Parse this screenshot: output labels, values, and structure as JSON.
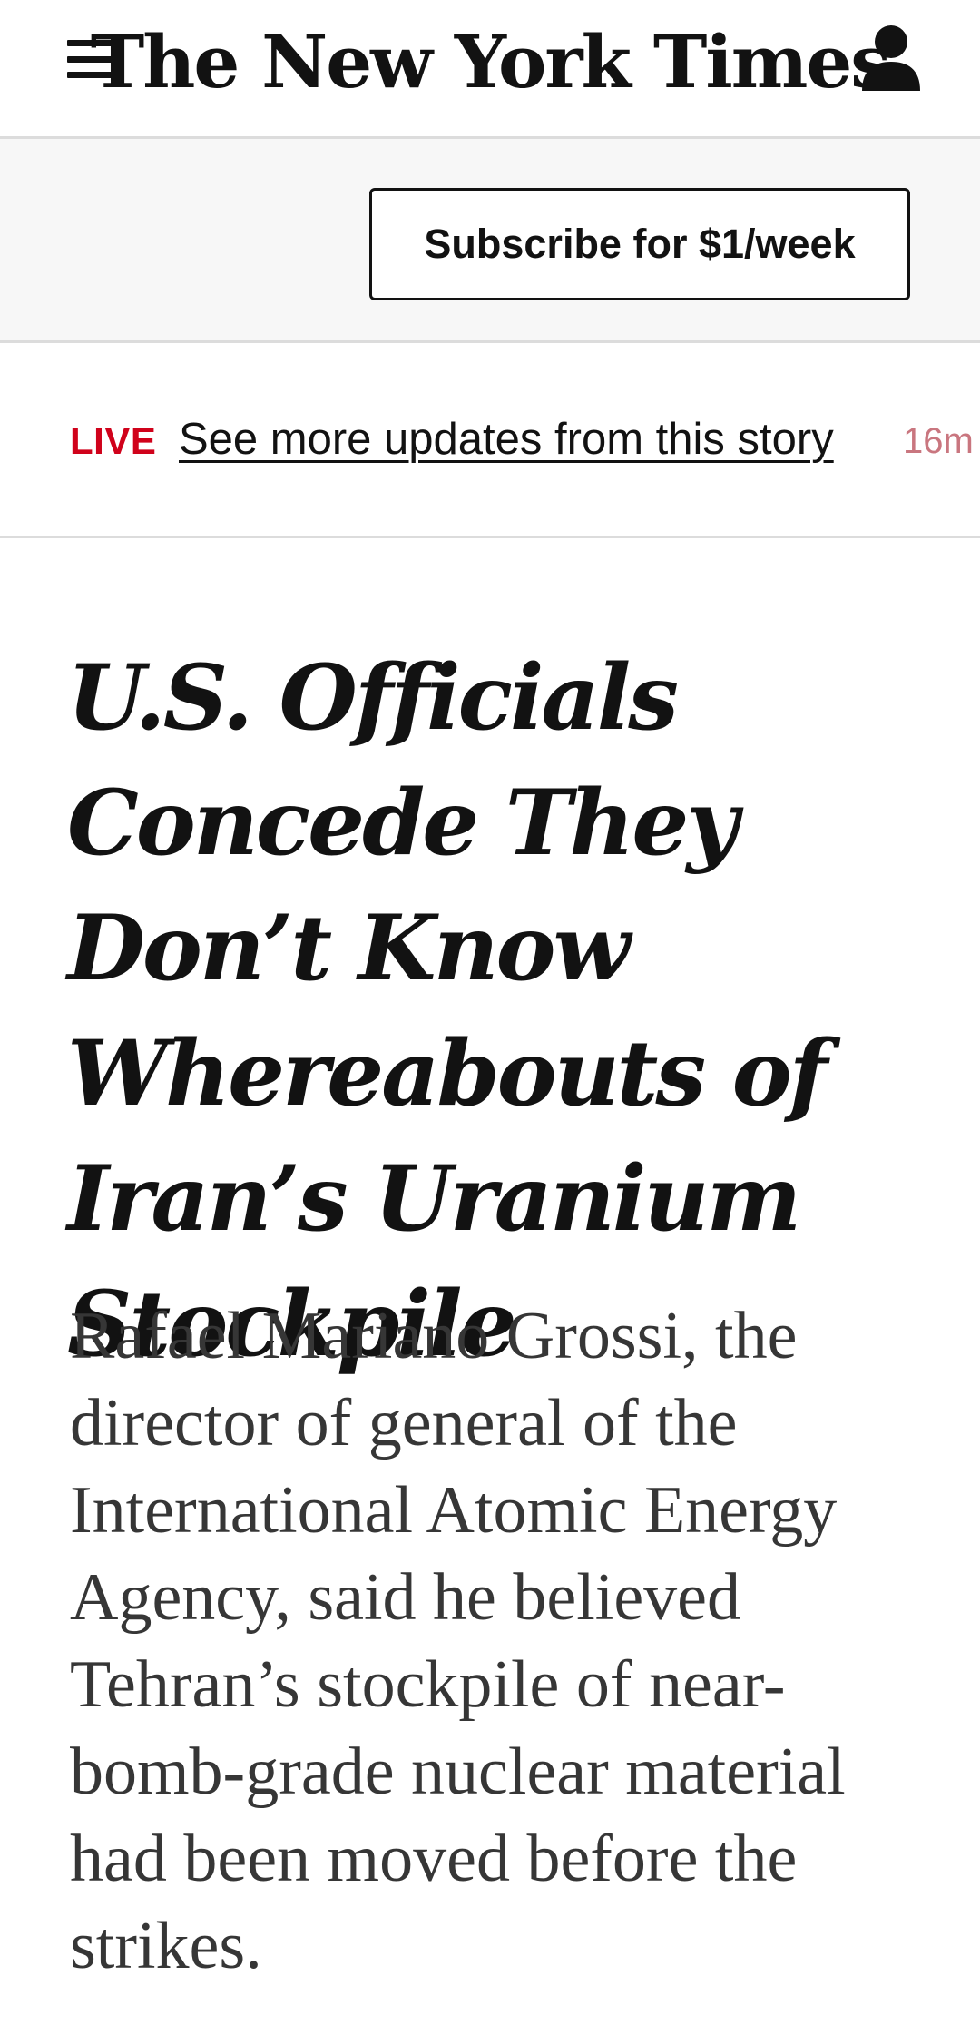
{
  "header": {
    "masthead": "The New York Times",
    "menu_icon": "hamburger-menu-icon",
    "account_icon": "user-account-icon"
  },
  "subscribe": {
    "label": "Subscribe for $1/week"
  },
  "live": {
    "label": "LIVE",
    "link_text": "See more updates from this story",
    "time": "16m"
  },
  "article": {
    "headline": "U.S. Officials Concede They Don’t Know Whereabouts of Iran’s Uranium Stockpile",
    "summary": "Rafael Mariano Grossi, the director of general of the International Atomic Energy Agency, said he believed Tehran’s stockpile of near-bomb-grade nuclear material had been moved before the strikes."
  },
  "colors": {
    "live_red": "#d0021b",
    "text": "#121212",
    "summary_text": "#363636",
    "band_gray": "#f7f7f7",
    "divider": "#dcdcdc"
  }
}
